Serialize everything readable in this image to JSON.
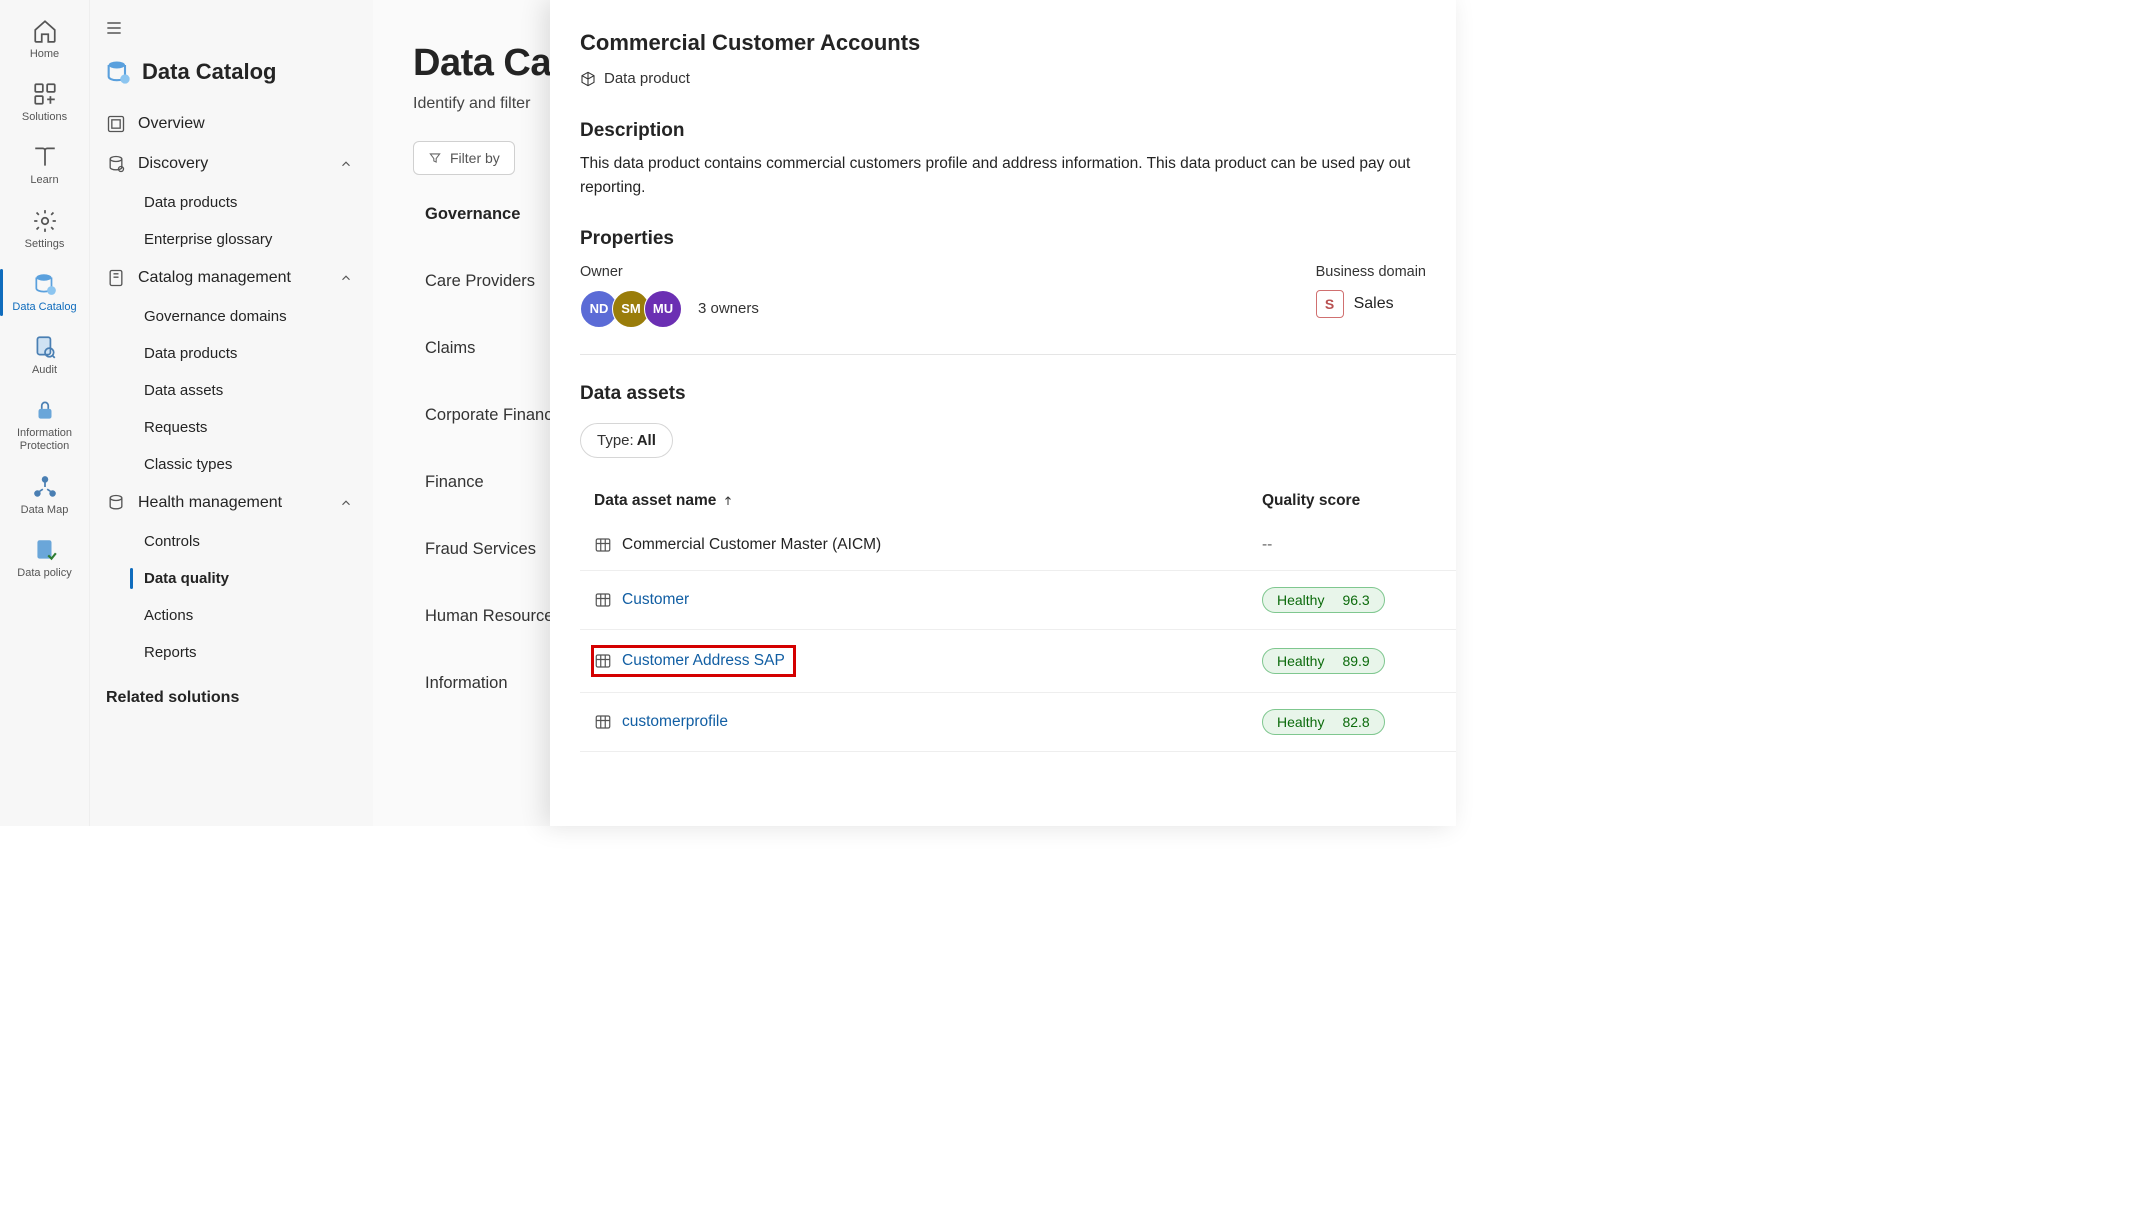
{
  "rail": {
    "items": [
      {
        "id": "home",
        "label": "Home"
      },
      {
        "id": "solutions",
        "label": "Solutions"
      },
      {
        "id": "learn",
        "label": "Learn"
      },
      {
        "id": "settings",
        "label": "Settings"
      },
      {
        "id": "data-catalog",
        "label": "Data Catalog",
        "active": true
      },
      {
        "id": "audit",
        "label": "Audit"
      },
      {
        "id": "info-protect",
        "label": "Information Protection"
      },
      {
        "id": "data-map",
        "label": "Data Map"
      },
      {
        "id": "data-policy",
        "label": "Data policy"
      }
    ]
  },
  "sidenav": {
    "title": "Data Catalog",
    "items": {
      "overview": "Overview",
      "discovery": "Discovery",
      "discovery_children": [
        "Data products",
        "Enterprise glossary"
      ],
      "catalog_mgmt": "Catalog management",
      "catalog_children": [
        "Governance domains",
        "Data products",
        "Data assets",
        "Requests",
        "Classic types"
      ],
      "health": "Health management",
      "health_children": [
        "Controls",
        "Data quality",
        "Actions",
        "Reports"
      ],
      "related_label": "Related solutions"
    }
  },
  "main": {
    "heading": "Data Catalog",
    "subtitle": "Identify and filter",
    "filter_placeholder": "Filter by",
    "gov_heading": "Governance",
    "gov_items": [
      "Care Providers",
      "Claims",
      "Corporate Finance",
      "Finance",
      "Fraud Services",
      "Human Resources",
      "Information"
    ]
  },
  "details": {
    "title": "Commercial Customer Accounts",
    "type_label": "Data product",
    "description_heading": "Description",
    "description_text": "This data product contains commercial customers profile and address information. This data product can be used pay out reporting.",
    "properties_heading": "Properties",
    "owner_label": "Owner",
    "owner_avatars": [
      {
        "initials": "ND",
        "color": "#5b6bd6"
      },
      {
        "initials": "SM",
        "color": "#9a7d0a"
      },
      {
        "initials": "MU",
        "color": "#6b2fb3"
      }
    ],
    "owners_count": "3 owners",
    "business_domain_label": "Business domain",
    "business_domain_value": "Sales",
    "business_domain_chip": "S",
    "assets_heading": "Data assets",
    "type_filter_label": "Type:",
    "type_filter_value": "All",
    "col_name": "Data asset name",
    "col_score": "Quality score",
    "assets": [
      {
        "name": "Commercial Customer Master (AICM)",
        "link": false,
        "score": "--",
        "healthy": false
      },
      {
        "name": "Customer",
        "link": true,
        "score": "96.3",
        "healthy": true
      },
      {
        "name": "Customer Address SAP",
        "link": true,
        "score": "89.9",
        "healthy": true,
        "highlight": true
      },
      {
        "name": "customerprofile",
        "link": true,
        "score": "82.8",
        "healthy": true
      }
    ],
    "healthy_label": "Healthy"
  }
}
